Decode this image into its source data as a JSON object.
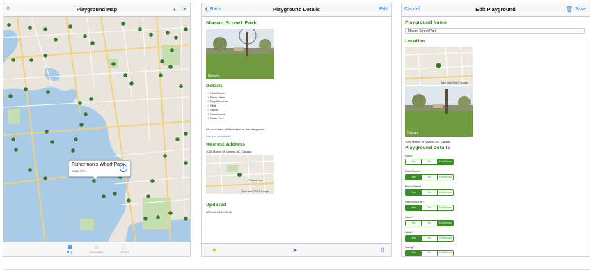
{
  "screen1": {
    "title": "Playground Map",
    "callout": {
      "title": "Fisherman's Wharf Park",
      "subtitle": "More Info..."
    },
    "tabs": [
      {
        "label": "Map"
      },
      {
        "label": "Favorites"
      },
      {
        "label": "About"
      }
    ]
  },
  "screen2": {
    "back_label": "Back",
    "title": "Playground Details",
    "edit_label": "Edit",
    "park_name": "Mason Street Park",
    "details_heading": "Details",
    "details_items": [
      {
        "mark": "×",
        "label": "Park Bench"
      },
      {
        "mark": "?",
        "label": "Picnic Table"
      },
      {
        "mark": "?",
        "label": "Play Structure"
      },
      {
        "mark": "?",
        "label": "Slide"
      },
      {
        "mark": "?",
        "label": "Swing"
      },
      {
        "mark": "✔",
        "label": "Washrooms"
      },
      {
        "mark": "✔",
        "label": "Water Park"
      }
    ],
    "missing_text": "We don't have all the details for this playground.",
    "contribute_link": "Can you contribute?",
    "address_heading": "Nearest Address",
    "address": "1065 Mason St, Victoria BC, Canada",
    "updated_heading": "Updated",
    "updated_value": "2014-04-16 10:08:48",
    "map_street": "Pandora Ave",
    "map_credit": "Map data ©2015 Google"
  },
  "screen3": {
    "cancel_label": "Cancel",
    "title": "Edit Playground",
    "save_label": "Save",
    "name_heading": "Playground Name",
    "name_value": "Mason Street Park",
    "location_heading": "Location",
    "map_credit": "Map data ©2015 Google",
    "address": "1065 Mason St, Victoria BC, Canada",
    "details_heading": "Playground Details",
    "segment_options": [
      "Yes",
      "No",
      "Don't Know"
    ],
    "questions": [
      {
        "label": "Field?",
        "selected": 2
      },
      {
        "label": "Park Bench?",
        "selected": 0
      },
      {
        "label": "Picnic Table?",
        "selected": 0
      },
      {
        "label": "Play Structure?",
        "selected": 0
      },
      {
        "label": "Sand?",
        "selected": 2
      },
      {
        "label": "Slide?",
        "selected": 0
      },
      {
        "label": "Swing?",
        "selected": 0
      }
    ]
  },
  "colors": {
    "accent": "#2a7ae2",
    "green": "#3d8a2a",
    "map_water": "#a9cbe8",
    "map_land": "#e9e5dc",
    "park": "#c6dfb1"
  },
  "photo_logo": "Google"
}
